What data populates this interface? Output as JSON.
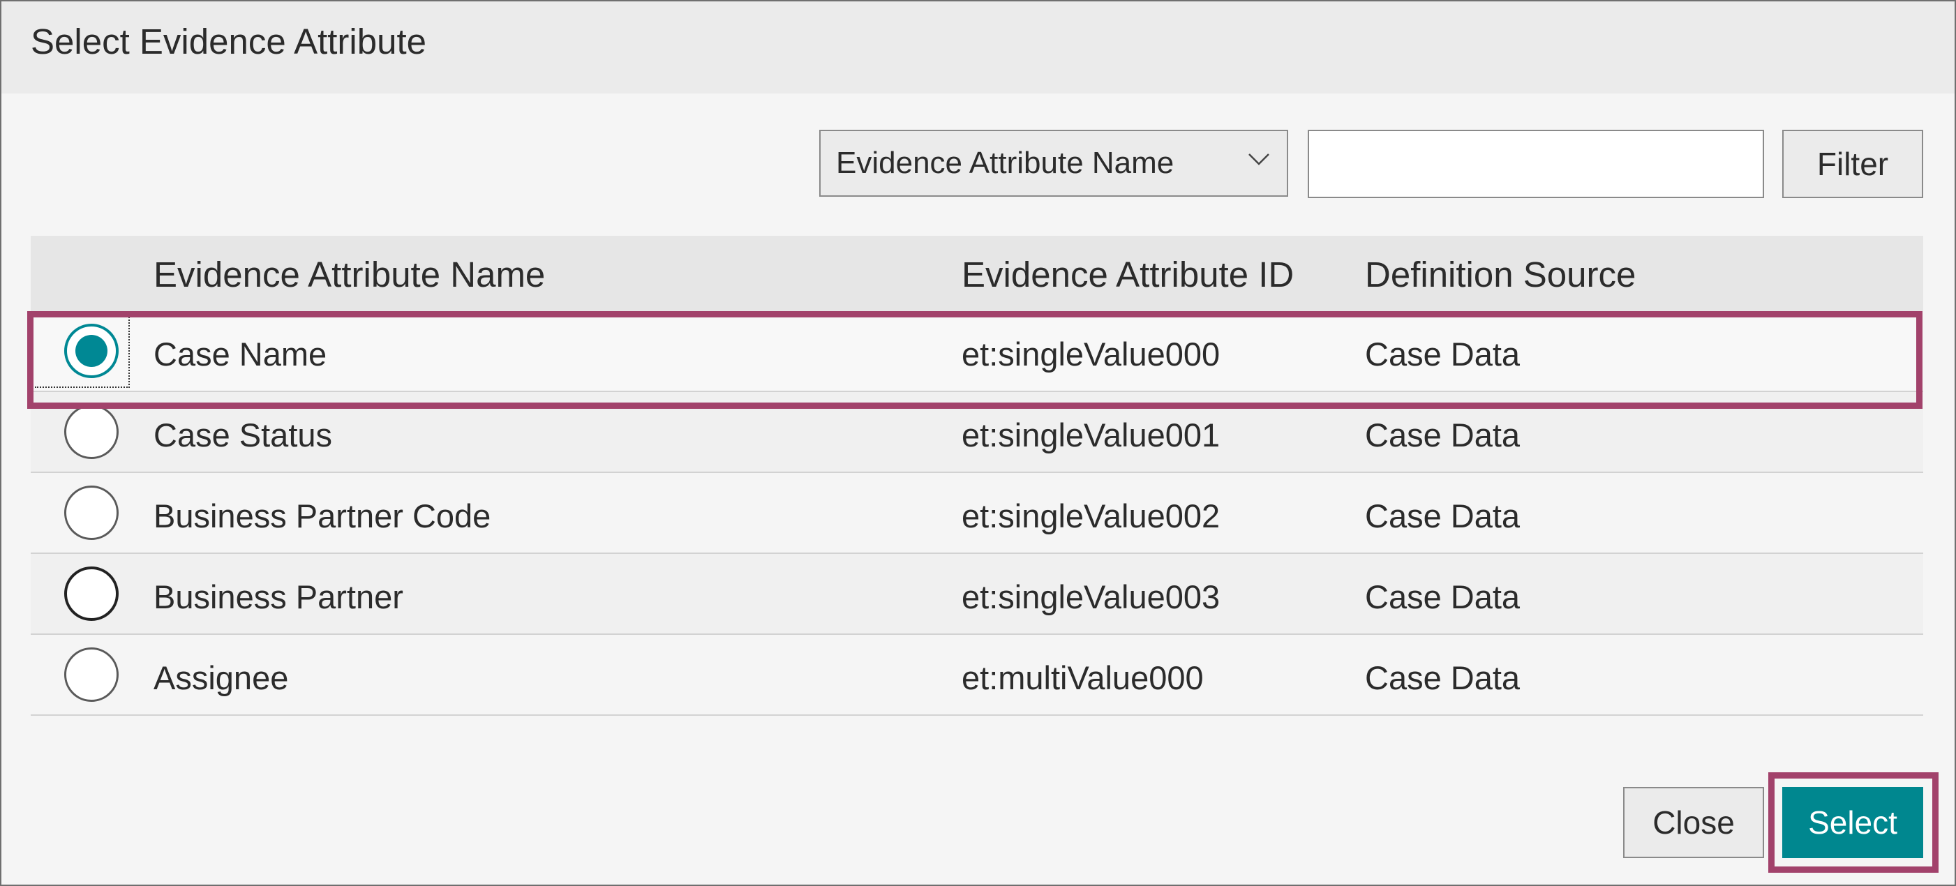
{
  "dialog": {
    "title": "Select Evidence Attribute"
  },
  "filter": {
    "field_selected": "Evidence Attribute Name",
    "query_value": "",
    "button_label": "Filter"
  },
  "table": {
    "columns": [
      "Evidence Attribute Name",
      "Evidence Attribute ID",
      "Definition Source"
    ],
    "rows": [
      {
        "name": "Case Name",
        "id": "et:singleValue000",
        "source": "Case Data",
        "selected": true
      },
      {
        "name": "Case Status",
        "id": "et:singleValue001",
        "source": "Case Data",
        "selected": false
      },
      {
        "name": "Business Partner Code",
        "id": "et:singleValue002",
        "source": "Case Data",
        "selected": false
      },
      {
        "name": "Business Partner",
        "id": "et:singleValue003",
        "source": "Case Data",
        "selected": false
      },
      {
        "name": "Assignee",
        "id": "et:multiValue000",
        "source": "Case Data",
        "selected": false
      }
    ]
  },
  "footer": {
    "close_label": "Close",
    "select_label": "Select"
  },
  "colors": {
    "accent": "#00878f",
    "highlight": "#a2426b"
  }
}
